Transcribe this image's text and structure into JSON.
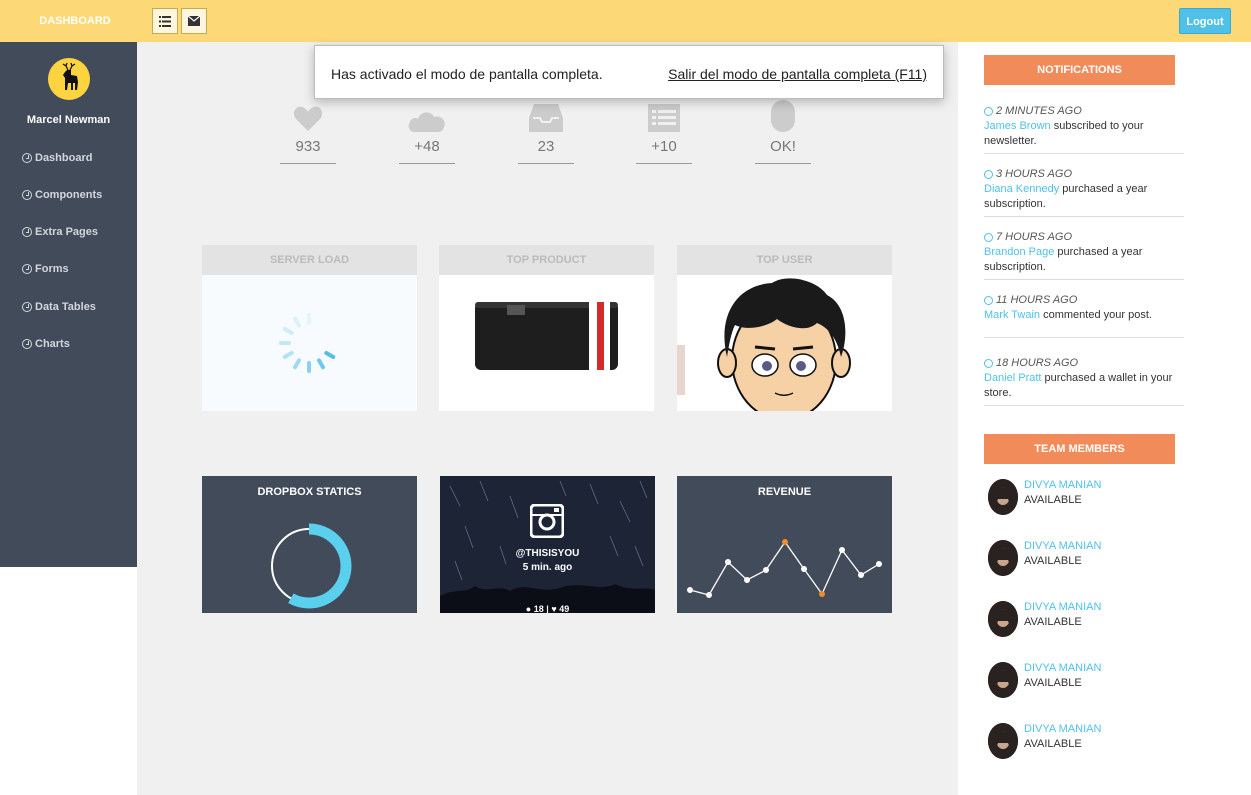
{
  "topbar": {
    "brand": "DASHBOARD",
    "logout_label": "Logout"
  },
  "sidebar": {
    "user_name": "Marcel Newman",
    "items": [
      {
        "label": "Dashboard"
      },
      {
        "label": "Components"
      },
      {
        "label": "Extra Pages"
      },
      {
        "label": "Forms"
      },
      {
        "label": "Data Tables"
      },
      {
        "label": "Charts"
      }
    ]
  },
  "toast": {
    "message": "Has activado el modo de pantalla completa.",
    "exit_label": "Salir del modo de pantalla completa (F11)"
  },
  "stats": [
    {
      "icon": "heart-icon",
      "value": "933"
    },
    {
      "icon": "cloud-icon",
      "value": "+48"
    },
    {
      "icon": "inbox-icon",
      "value": "23"
    },
    {
      "icon": "list-icon",
      "value": "+10"
    },
    {
      "icon": "mouse-icon",
      "value": "OK!"
    }
  ],
  "panels": {
    "server_load": "SERVER LOAD",
    "top_product": "TOP PRODUCT",
    "top_user": "TOP USER",
    "dropbox": "DROPBOX STATICS",
    "instagram_handle": "@THISISYOU",
    "instagram_time": "5 min. ago",
    "instagram_comments": "18",
    "instagram_sep": "|",
    "instagram_likes": "49",
    "revenue": "REVENUE"
  },
  "notifications": {
    "title": "NOTIFICATIONS",
    "items": [
      {
        "time": "2 MINUTES AGO",
        "who": "James Brown",
        "text": " subscribed to your newsletter."
      },
      {
        "time": "3 HOURS AGO",
        "who": "Diana Kennedy",
        "text": " purchased a year subscription."
      },
      {
        "time": "7 HOURS AGO",
        "who": "Brandon Page",
        "text": " purchased a year subscription."
      },
      {
        "time": "11 HOURS AGO",
        "who": "Mark Twain",
        "text": " commented your post."
      },
      {
        "time": "18 HOURS AGO",
        "who": "Daniel Pratt",
        "text": " purchased a wallet in your store."
      }
    ]
  },
  "team": {
    "title": "TEAM MEMBERS",
    "members": [
      {
        "name": "DIVYA MANIAN",
        "status": "AVAILABLE"
      },
      {
        "name": "DIVYA MANIAN",
        "status": "AVAILABLE"
      },
      {
        "name": "DIVYA MANIAN",
        "status": "AVAILABLE"
      },
      {
        "name": "DIVYA MANIAN",
        "status": "AVAILABLE"
      },
      {
        "name": "DIVYA MANIAN",
        "status": "AVAILABLE"
      }
    ]
  },
  "colors": {
    "topbar": "#fdd876",
    "sidebar": "#414b5a",
    "accent": "#4fc1e9",
    "orange": "#f28b5a"
  }
}
